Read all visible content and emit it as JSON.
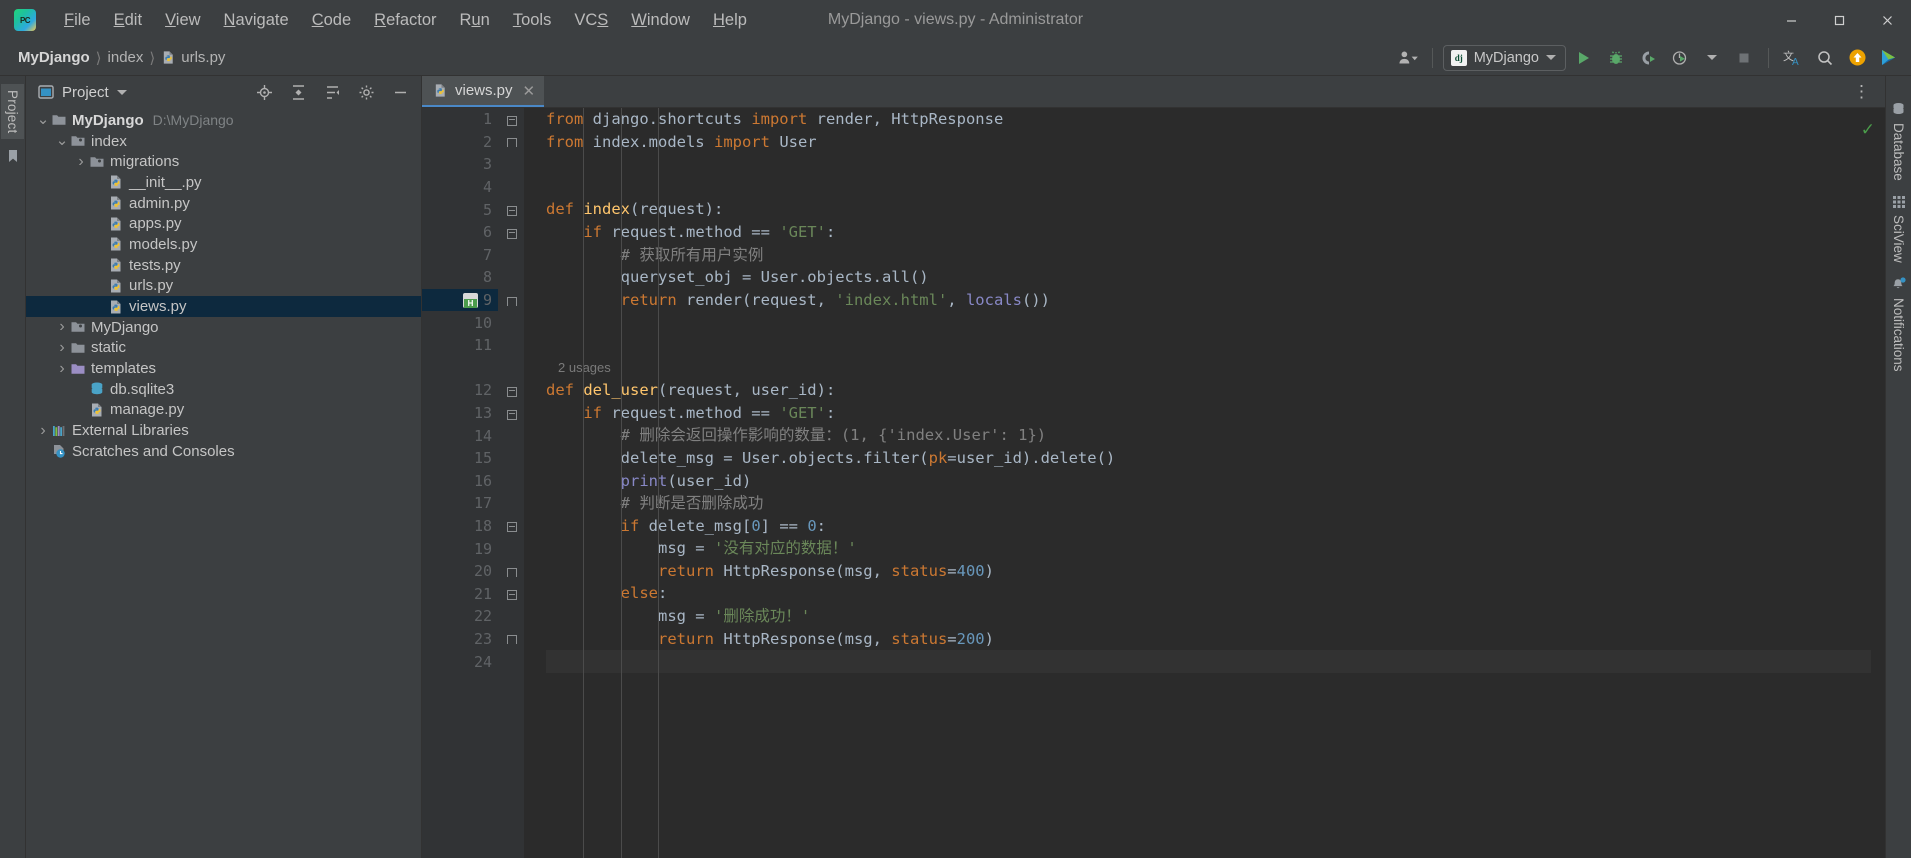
{
  "window": {
    "title": "MyDjango - views.py - Administrator",
    "minimize_label": "—",
    "maximize_label": "☐",
    "close_label": "✕"
  },
  "menubar": {
    "items": [
      {
        "label": "File",
        "mnemonic": "F"
      },
      {
        "label": "Edit",
        "mnemonic": "E"
      },
      {
        "label": "View",
        "mnemonic": "V"
      },
      {
        "label": "Navigate",
        "mnemonic": "N"
      },
      {
        "label": "Code",
        "mnemonic": "C"
      },
      {
        "label": "Refactor",
        "mnemonic": "R"
      },
      {
        "label": "Run",
        "mnemonic": "u"
      },
      {
        "label": "Tools",
        "mnemonic": "T"
      },
      {
        "label": "VCS",
        "mnemonic": "S"
      },
      {
        "label": "Window",
        "mnemonic": "W"
      },
      {
        "label": "Help",
        "mnemonic": "H"
      }
    ]
  },
  "breadcrumb": {
    "items": [
      "MyDjango",
      "index",
      "urls.py"
    ],
    "separator": "⟩"
  },
  "toolbar": {
    "run_config": "MyDjango",
    "run_config_icon": "django-icon",
    "buttons": [
      "account-icon",
      "run-icon",
      "debug-icon",
      "coverage-icon",
      "profiler-icon",
      "stop-icon",
      "translate-icon",
      "search-icon",
      "update-icon",
      "ide-feature-icon"
    ]
  },
  "left_rail": {
    "project_tab": "Project",
    "structure_icon": "bookmark-icon"
  },
  "project_panel": {
    "title": "Project",
    "header_icons": [
      "target-icon",
      "collapse-all-icon",
      "expand-all-icon",
      "settings-icon",
      "hide-icon"
    ],
    "tree": [
      {
        "label": "MyDjango",
        "path": "D:\\MyDjango",
        "icon": "folder-root-icon",
        "arrow": "down",
        "depth": 0,
        "bold": true
      },
      {
        "label": "index",
        "icon": "folder-module-icon",
        "arrow": "down",
        "depth": 1
      },
      {
        "label": "migrations",
        "icon": "folder-module-icon",
        "arrow": "right",
        "depth": 2
      },
      {
        "label": "__init__.py",
        "icon": "python-file-icon",
        "arrow": "none",
        "depth": 3
      },
      {
        "label": "admin.py",
        "icon": "python-file-icon",
        "arrow": "none",
        "depth": 3
      },
      {
        "label": "apps.py",
        "icon": "python-file-icon",
        "arrow": "none",
        "depth": 3
      },
      {
        "label": "models.py",
        "icon": "python-file-icon",
        "arrow": "none",
        "depth": 3
      },
      {
        "label": "tests.py",
        "icon": "python-file-icon",
        "arrow": "none",
        "depth": 3
      },
      {
        "label": "urls.py",
        "icon": "python-file-icon",
        "arrow": "none",
        "depth": 3
      },
      {
        "label": "views.py",
        "icon": "python-file-icon",
        "arrow": "none",
        "depth": 3,
        "selected": true
      },
      {
        "label": "MyDjango",
        "icon": "folder-module-icon",
        "arrow": "right",
        "depth": 1
      },
      {
        "label": "static",
        "icon": "folder-icon",
        "arrow": "right",
        "depth": 1
      },
      {
        "label": "templates",
        "icon": "folder-templates-icon",
        "arrow": "right",
        "depth": 1
      },
      {
        "label": "db.sqlite3",
        "icon": "database-file-icon",
        "arrow": "none",
        "depth": 2
      },
      {
        "label": "manage.py",
        "icon": "python-file-icon",
        "arrow": "none",
        "depth": 2
      },
      {
        "label": "External Libraries",
        "icon": "libraries-icon",
        "arrow": "right",
        "depth": 0
      },
      {
        "label": "Scratches and Consoles",
        "icon": "scratches-icon",
        "arrow": "none",
        "depth": 0
      }
    ]
  },
  "editor": {
    "tab": {
      "label": "views.py",
      "icon": "python-file-icon",
      "close": "✕"
    },
    "more_actions": "⋮",
    "inspection_status": "✓",
    "lines": [
      {
        "n": 1,
        "fold": "down",
        "tokens": [
          [
            "kw",
            "from"
          ],
          [
            "plain",
            " django.shortcuts "
          ],
          [
            "kw",
            "import"
          ],
          [
            "plain",
            " render, HttpResponse"
          ]
        ]
      },
      {
        "n": 2,
        "fold": "end",
        "tokens": [
          [
            "kw",
            "from"
          ],
          [
            "plain",
            " index.models "
          ],
          [
            "kw",
            "import"
          ],
          [
            "plain",
            " User"
          ]
        ]
      },
      {
        "n": 3,
        "fold": "",
        "tokens": []
      },
      {
        "n": 4,
        "fold": "",
        "tokens": []
      },
      {
        "n": 5,
        "fold": "down",
        "tokens": [
          [
            "kw",
            "def"
          ],
          [
            "plain",
            " "
          ],
          [
            "fn",
            "index"
          ],
          [
            "plain",
            "(request):"
          ]
        ]
      },
      {
        "n": 6,
        "fold": "down",
        "indent": 1,
        "tokens": [
          [
            "plain",
            "    "
          ],
          [
            "kw",
            "if"
          ],
          [
            "plain",
            " request.method == "
          ],
          [
            "str",
            "'GET'"
          ],
          [
            "plain",
            ":"
          ]
        ]
      },
      {
        "n": 7,
        "fold": "",
        "indent": 2,
        "tokens": [
          [
            "plain",
            "        "
          ],
          [
            "cmt",
            "# 获取所有用户实例"
          ]
        ]
      },
      {
        "n": 8,
        "fold": "",
        "indent": 2,
        "tokens": [
          [
            "plain",
            "        queryset_obj = User.objects.all()"
          ]
        ]
      },
      {
        "n": 9,
        "fold": "end",
        "indent": 2,
        "marker": "html-marker",
        "tokens": [
          [
            "plain",
            "        "
          ],
          [
            "kw",
            "return"
          ],
          [
            "plain",
            " render(request, "
          ],
          [
            "str",
            "'index.html'"
          ],
          [
            "plain",
            ", "
          ],
          [
            "bif",
            "locals"
          ],
          [
            "plain",
            "())"
          ]
        ]
      },
      {
        "n": 10,
        "fold": "",
        "tokens": []
      },
      {
        "n": 11,
        "fold": "",
        "tokens": []
      },
      {
        "n": null,
        "inlay": "2 usages"
      },
      {
        "n": 12,
        "fold": "down",
        "tokens": [
          [
            "kw",
            "def"
          ],
          [
            "plain",
            " "
          ],
          [
            "fn",
            "del_user"
          ],
          [
            "plain",
            "(request, user_id):"
          ]
        ]
      },
      {
        "n": 13,
        "fold": "down",
        "indent": 1,
        "tokens": [
          [
            "plain",
            "    "
          ],
          [
            "kw",
            "if"
          ],
          [
            "plain",
            " request.method == "
          ],
          [
            "str",
            "'GET'"
          ],
          [
            "plain",
            ":"
          ]
        ]
      },
      {
        "n": 14,
        "fold": "",
        "indent": 2,
        "tokens": [
          [
            "plain",
            "        "
          ],
          [
            "cmt",
            "# 删除会返回操作影响的数量：(1, {'index.User': 1})"
          ]
        ]
      },
      {
        "n": 15,
        "fold": "",
        "indent": 2,
        "tokens": [
          [
            "plain",
            "        delete_msg = User.objects.filter("
          ],
          [
            "kwarg",
            "pk"
          ],
          [
            "plain",
            "=user_id).delete()"
          ]
        ]
      },
      {
        "n": 16,
        "fold": "",
        "indent": 2,
        "tokens": [
          [
            "plain",
            "        "
          ],
          [
            "bif",
            "print"
          ],
          [
            "plain",
            "(user_id)"
          ]
        ]
      },
      {
        "n": 17,
        "fold": "",
        "indent": 2,
        "tokens": [
          [
            "plain",
            "        "
          ],
          [
            "cmt",
            "# 判断是否删除成功"
          ]
        ]
      },
      {
        "n": 18,
        "fold": "down",
        "indent": 2,
        "tokens": [
          [
            "plain",
            "        "
          ],
          [
            "kw",
            "if"
          ],
          [
            "plain",
            " delete_msg["
          ],
          [
            "num",
            "0"
          ],
          [
            "plain",
            "] == "
          ],
          [
            "num",
            "0"
          ],
          [
            "plain",
            ":"
          ]
        ]
      },
      {
        "n": 19,
        "fold": "",
        "indent": 3,
        "tokens": [
          [
            "plain",
            "            msg = "
          ],
          [
            "str",
            "'没有对应的数据！'"
          ]
        ]
      },
      {
        "n": 20,
        "fold": "end",
        "indent": 3,
        "tokens": [
          [
            "plain",
            "            "
          ],
          [
            "kw",
            "return"
          ],
          [
            "plain",
            " HttpResponse(msg, "
          ],
          [
            "kwarg",
            "status"
          ],
          [
            "plain",
            "="
          ],
          [
            "num",
            "400"
          ],
          [
            "plain",
            ")"
          ]
        ]
      },
      {
        "n": 21,
        "fold": "down",
        "indent": 2,
        "tokens": [
          [
            "plain",
            "        "
          ],
          [
            "kw",
            "else"
          ],
          [
            "plain",
            ":"
          ]
        ]
      },
      {
        "n": 22,
        "fold": "",
        "indent": 3,
        "tokens": [
          [
            "plain",
            "            msg = "
          ],
          [
            "str",
            "'删除成功！'"
          ]
        ]
      },
      {
        "n": 23,
        "fold": "end",
        "indent": 3,
        "tokens": [
          [
            "plain",
            "            "
          ],
          [
            "kw",
            "return"
          ],
          [
            "plain",
            " HttpResponse(msg, "
          ],
          [
            "kwarg",
            "status"
          ],
          [
            "plain",
            "="
          ],
          [
            "num",
            "200"
          ],
          [
            "plain",
            ")"
          ]
        ]
      },
      {
        "n": 24,
        "fold": "",
        "caret": true,
        "tokens": []
      }
    ]
  },
  "right_rail": {
    "items": [
      {
        "label": "Database",
        "icon": "database-icon"
      },
      {
        "label": "SciView",
        "icon": "grid-icon"
      },
      {
        "label": "Notifications",
        "icon": "bell-icon",
        "badge": true
      }
    ]
  },
  "colors": {
    "accent": "#4a88c7",
    "keyword": "#cc7832",
    "string": "#6a8759",
    "number": "#6897bb",
    "comment": "#808080",
    "function": "#ffc66d",
    "builtin": "#8888c6",
    "selection": "#0d293e",
    "editor_bg": "#2b2b2b",
    "panel_bg": "#3c3f41"
  }
}
